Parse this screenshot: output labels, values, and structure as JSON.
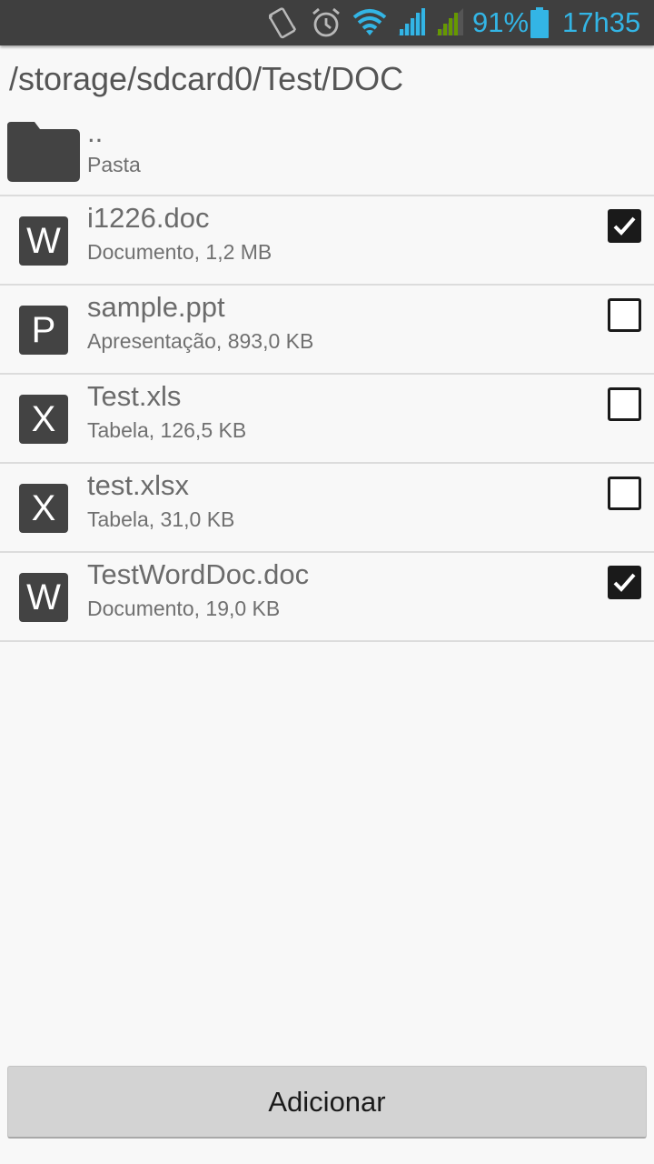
{
  "status_bar": {
    "battery_percent": "91%",
    "time": "17h35",
    "icons": [
      "vibrate-icon",
      "alarm-icon",
      "wifi-icon",
      "signal-sim1-icon",
      "signal-sim2-icon",
      "battery-icon"
    ],
    "colors": {
      "accent": "#33b5e5",
      "sim2": "#669900",
      "background": "#3f3f3f"
    }
  },
  "path": "/storage/sdcard0/Test/DOC",
  "parent": {
    "name": "..",
    "description": "Pasta",
    "icon": "folder-icon"
  },
  "files": [
    {
      "name": "i1226.doc",
      "description": "Documento, 1,2 MB",
      "icon_letter": "W",
      "icon": "word-doc-icon",
      "checked": true
    },
    {
      "name": "sample.ppt",
      "description": "Apresentação, 893,0 KB",
      "icon_letter": "P",
      "icon": "powerpoint-doc-icon",
      "checked": false
    },
    {
      "name": "Test.xls",
      "description": "Tabela, 126,5 KB",
      "icon_letter": "X",
      "icon": "excel-doc-icon",
      "checked": false
    },
    {
      "name": "test.xlsx",
      "description": "Tabela, 31,0 KB",
      "icon_letter": "X",
      "icon": "excel-doc-icon",
      "checked": false
    },
    {
      "name": "TestWordDoc.doc",
      "description": "Documento, 19,0 KB",
      "icon_letter": "W",
      "icon": "word-doc-icon",
      "checked": true
    }
  ],
  "add_button_label": "Adicionar"
}
